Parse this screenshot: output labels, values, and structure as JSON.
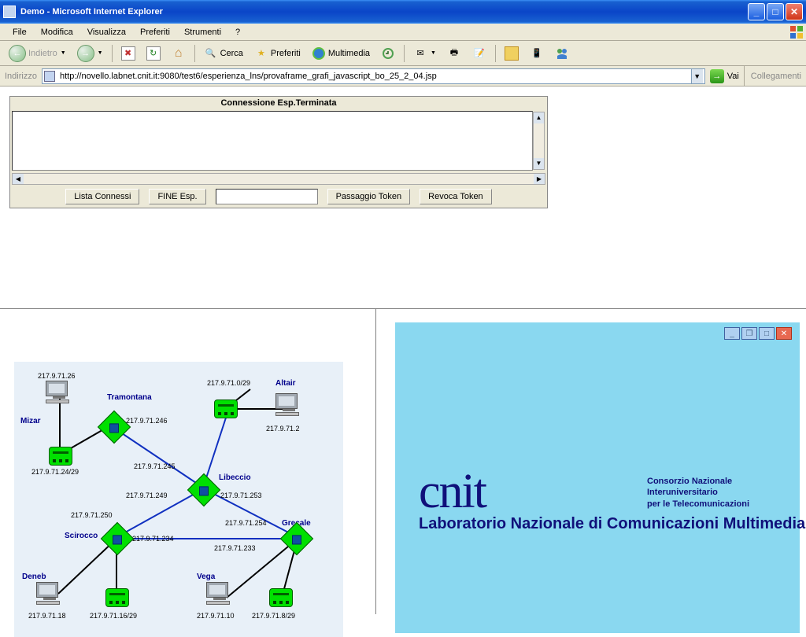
{
  "window": {
    "title": "Demo - Microsoft Internet Explorer"
  },
  "menu": {
    "file": "File",
    "edit": "Modifica",
    "view": "Visualizza",
    "favorites": "Preferiti",
    "tools": "Strumenti",
    "help": "?"
  },
  "toolbar": {
    "back": "Indietro",
    "stop_char": "✖",
    "refresh_char": "↻",
    "home_char": "⌂",
    "search": "Cerca",
    "favorites": "Preferiti",
    "media": "Multimedia"
  },
  "address": {
    "label": "Indirizzo",
    "url": "http://novello.labnet.cnit.it:9080/test6/esperienza_lns/provaframe_grafi_javascript_bo_25_2_04.jsp",
    "go": "Vai",
    "links": "Collegamenti"
  },
  "panel": {
    "status_title": "Connessione Esp.Terminata",
    "btn_lista": "Lista Connessi",
    "btn_fine": "FINE Esp.",
    "input_value": "",
    "btn_passaggio": "Passaggio Token",
    "btn_revoca": "Revoca Token"
  },
  "graph": {
    "nodes": {
      "mizar": {
        "label": "Mizar",
        "ip": "217.9.71.26",
        "subnet": "217.9.71.24/29"
      },
      "tramontana": {
        "label": "Tramontana",
        "ip": "217.9.71.246"
      },
      "altair": {
        "label": "Altair",
        "ip": "217.9.71.2",
        "subnet": "217.9.71.0/29"
      },
      "libeccio": {
        "label": "Libeccio",
        "ip_up": "217.9.71.245",
        "ip_left": "217.9.71.249",
        "ip_right": "217.9.71.253"
      },
      "scirocco": {
        "label": "Scirocco",
        "ip_up": "217.9.71.250",
        "ip_right": "217.9.71.234"
      },
      "grecale": {
        "label": "Grecale",
        "ip_up": "217.9.71.254",
        "ip_left": "217.9.71.233"
      },
      "deneb": {
        "label": "Deneb",
        "ip": "217.9.71.18",
        "subnet": "217.9.71.16/29"
      },
      "vega": {
        "label": "Vega",
        "ip": "217.9.71.10",
        "subnet": "217.9.71.8/29"
      }
    }
  },
  "logo": {
    "brand": "cnit",
    "desc1": "Consorzio Nazionale",
    "desc2": "Interuniversitario",
    "desc3": "per le Telecomunicazioni",
    "lab": "Laboratorio Nazionale di Comunicazioni Multimediali"
  }
}
